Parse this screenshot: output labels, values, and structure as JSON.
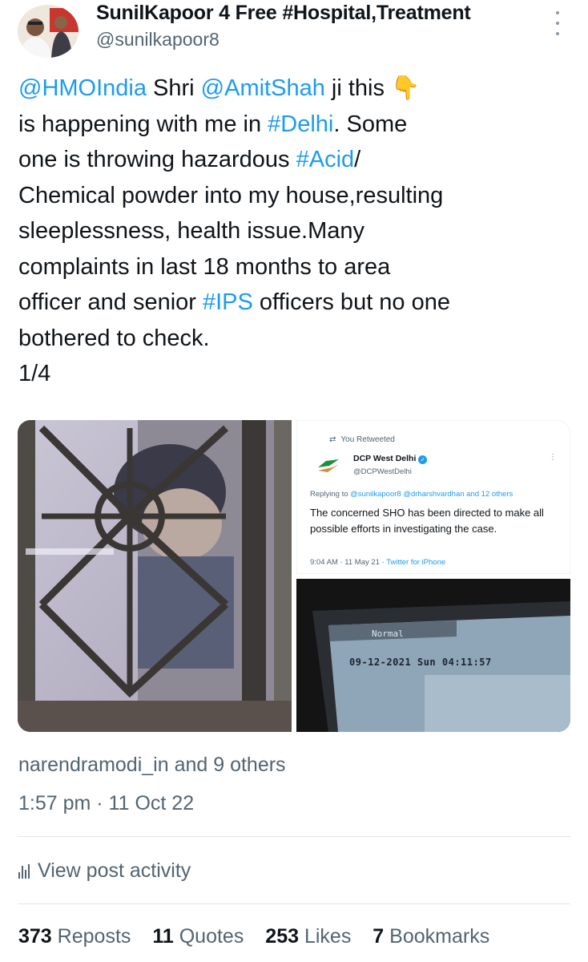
{
  "author": {
    "display_name": "SunilKapoor 4 Free #Hospital,Treatment",
    "handle": "@sunilkapoor8"
  },
  "tweet": {
    "segments": [
      {
        "text": "@HMOIndia",
        "type": "mention"
      },
      {
        "text": " Shri ",
        "type": "text"
      },
      {
        "text": "@AmitShah",
        "type": "mention"
      },
      {
        "text": " ji this 👇\nis happening with me in ",
        "type": "text"
      },
      {
        "text": "#Delhi",
        "type": "hashtag"
      },
      {
        "text": ". Some\none is throwing hazardous ",
        "type": "text"
      },
      {
        "text": "#Acid",
        "type": "hashtag"
      },
      {
        "text": "/\nChemical powder into my house,resulting\nsleeplessness, health issue.Many\ncomplaints in last 18 months to area\nofficer and senior ",
        "type": "text"
      },
      {
        "text": "#IPS",
        "type": "hashtag"
      },
      {
        "text": " officers but no one\nbothered to check.\n1/4",
        "type": "text"
      }
    ]
  },
  "media_card": {
    "retweet_label": "You Retweeted",
    "name": "DCP West Delhi",
    "handle": "@DCPWestDelhi",
    "replying_prefix": "Replying to ",
    "replying_mentions": "@sunilkapoor8 @drharshvardhan",
    "replying_suffix": " and 12 others",
    "body": "The concerned SHO has been directed to make all possible efforts in investigating the case.",
    "time": "9:04 AM · 11 May 21 · ",
    "source": "Twitter for iPhone"
  },
  "monitor": {
    "label": "Normal",
    "timestamp": "09-12-2021 Sun 04:11:57"
  },
  "liked_by": "narendramodi_in and 9 others",
  "timestamp": "1:57 pm · 11 Oct 22",
  "activity_label": "View post activity",
  "stats": {
    "reposts_count": "373",
    "reposts_label": "Reposts",
    "quotes_count": "11",
    "quotes_label": "Quotes",
    "likes_count": "253",
    "likes_label": "Likes",
    "bookmarks_count": "7",
    "bookmarks_label": "Bookmarks"
  },
  "colors": {
    "link": "#1d9bf0",
    "secondary": "#536471",
    "text": "#0f1419"
  }
}
